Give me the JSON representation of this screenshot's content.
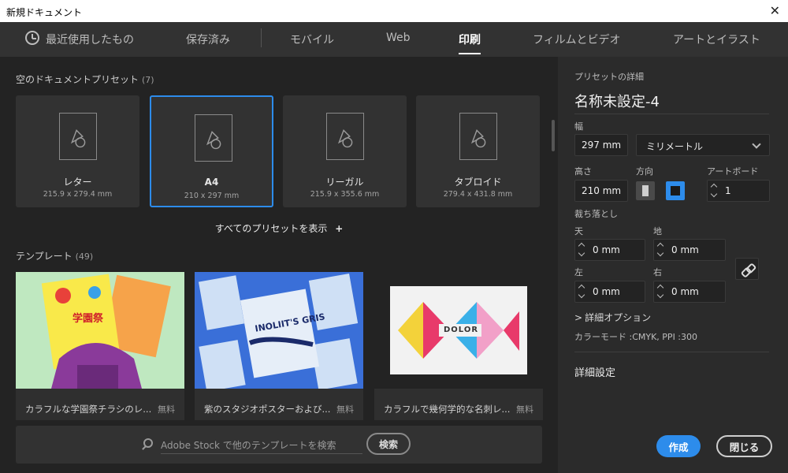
{
  "window": {
    "title": "新規ドキュメント",
    "close_glyph": "✕"
  },
  "tabs": [
    {
      "label": "最近使用したもの"
    },
    {
      "label": "保存済み"
    },
    {
      "label": "モバイル"
    },
    {
      "label": "Web"
    },
    {
      "label": "印刷"
    },
    {
      "label": "フィルムとビデオ"
    },
    {
      "label": "アートとイラスト"
    }
  ],
  "active_tab": "印刷",
  "presets_section": {
    "title": "空のドキュメントプリセット",
    "count": "(7)"
  },
  "presets": [
    {
      "name": "レター",
      "size": "215.9 x 279.4 mm"
    },
    {
      "name": "A4",
      "size": "210 x 297 mm",
      "selected": true
    },
    {
      "name": "リーガル",
      "size": "215.9 x 355.6 mm"
    },
    {
      "name": "タブロイド",
      "size": "279.4 x 431.8 mm"
    }
  ],
  "show_all_presets": "すべてのプリセットを表示",
  "show_all_plus": "+",
  "templates_section": {
    "title": "テンプレート",
    "count": "(49)"
  },
  "templates": [
    {
      "name": "カラフルな学園祭チラシのレ...",
      "price": "無料",
      "thumb_text": "学園祭"
    },
    {
      "name": "紫のスタジオポスターおよび...",
      "price": "無料",
      "thumb_text": "INOLIIT'S GRIS"
    },
    {
      "name": "カラフルで幾何学的な名刺レ...",
      "price": "無料",
      "thumb_text": "DOLOR"
    }
  ],
  "search": {
    "placeholder": "Adobe Stock で他のテンプレートを検索",
    "button": "検索"
  },
  "details": {
    "header": "プリセットの詳細",
    "doc_name": "名称未設定-4",
    "width_label": "幅",
    "width_value": "297 mm",
    "unit": "ミリメートル",
    "height_label": "高さ",
    "height_value": "210 mm",
    "orientation_label": "方向",
    "artboard_label": "アートボード",
    "artboard_value": "1",
    "bleed_label": "裁ち落とし",
    "bleed_top_label": "天",
    "bleed_top": "0 mm",
    "bleed_bottom_label": "地",
    "bleed_bottom": "0 mm",
    "bleed_left_label": "左",
    "bleed_left": "0 mm",
    "bleed_right_label": "右",
    "bleed_right": "0 mm",
    "advanced_options": "詳細オプション",
    "advanced_chevron": ">",
    "color_mode": "カラーモード :CMYK, PPI :300",
    "advanced_settings": "詳細設定"
  },
  "buttons": {
    "create": "作成",
    "close": "閉じる"
  },
  "colors": {
    "accent": "#2d8ceb",
    "panel": "#2b2b2b",
    "canvas": "#232323"
  }
}
